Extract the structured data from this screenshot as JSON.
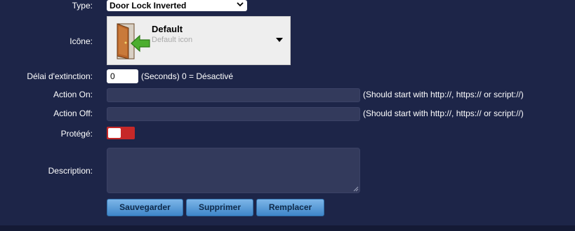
{
  "form": {
    "type": {
      "label": "Type:",
      "value": "Door Lock Inverted"
    },
    "icon": {
      "label": "Icône:",
      "name": "Default",
      "description": "Default icon",
      "image": "door-with-green-arrow-icon"
    },
    "off_delay": {
      "label": "Délai d'extinction:",
      "value": "0",
      "hint": "(Seconds) 0 = Désactivé"
    },
    "action_on": {
      "label": "Action On:",
      "value": "",
      "hint": "(Should start with http://, https:// or script://)"
    },
    "action_off": {
      "label": "Action Off:",
      "value": "",
      "hint": "(Should start with http://, https:// or script://)"
    },
    "protected": {
      "label": "Protégé:",
      "enabled": false
    },
    "description": {
      "label": "Description:",
      "value": ""
    }
  },
  "buttons": {
    "save": "Sauvegarder",
    "delete": "Supprimer",
    "replace": "Remplacer"
  },
  "colors": {
    "background": "#1d2548",
    "input_dark": "#333a5c",
    "toggle_off": "#c62828",
    "button": "#5a9ad8"
  }
}
